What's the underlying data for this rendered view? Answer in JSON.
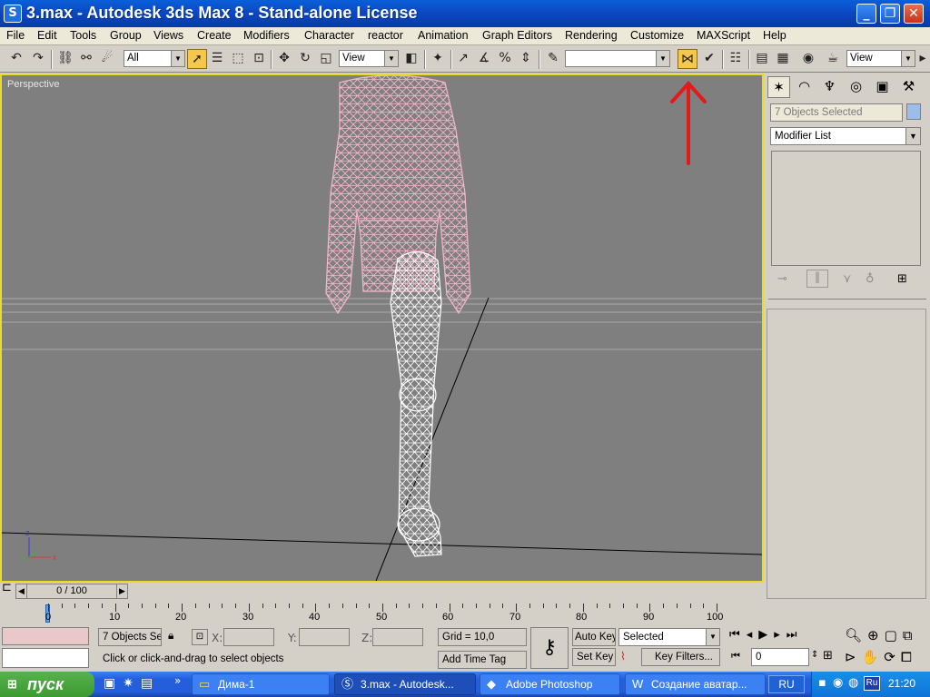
{
  "window": {
    "title": "3.max - Autodesk 3ds Max 8  - Stand-alone License",
    "app_icon": "3ds-max-icon"
  },
  "menu": [
    "File",
    "Edit",
    "Tools",
    "Group",
    "Views",
    "Create",
    "Modifiers",
    "Character",
    "reactor",
    "Animation",
    "Graph Editors",
    "Rendering",
    "Customize",
    "MAXScript",
    "Help"
  ],
  "toolbar": {
    "selection_filter": "All",
    "ref_coord": "View",
    "named_selection": "",
    "render_view": "View",
    "highlighted_tool": "mirror-icon"
  },
  "viewport": {
    "label": "Perspective",
    "axis": {
      "x": "x",
      "y": "y",
      "z": "z"
    },
    "border_color": "#e8dc28",
    "annotation": "red-arrow-icon"
  },
  "command_panel": {
    "selection_name": "7 Objects Selected",
    "modifier_list": "Modifier List"
  },
  "trackbar": {
    "time_slider": "0 / 100",
    "ticks": [
      "0",
      "10",
      "20",
      "30",
      "40",
      "50",
      "60",
      "70",
      "80",
      "90",
      "100"
    ]
  },
  "status": {
    "selection": "7 Objects Sele",
    "x_label": "X:",
    "y_label": "Y:",
    "z_label": "Z:",
    "grid": "Grid = 10,0",
    "add_time_tag": "Add Time Tag",
    "prompt": "Click or click-and-drag to select objects",
    "auto_key": "Auto Key",
    "set_key": "Set Key",
    "key_mode": "Selected",
    "key_filters": "Key Filters...",
    "frame": "0"
  },
  "taskbar": {
    "start": "пуск",
    "tasks": [
      "Дима-1",
      "3.max - Autodesk...",
      "Adobe Photoshop",
      "Создание аватар..."
    ],
    "language": "RU",
    "tray_lang": "Ru",
    "clock": "21:20"
  }
}
